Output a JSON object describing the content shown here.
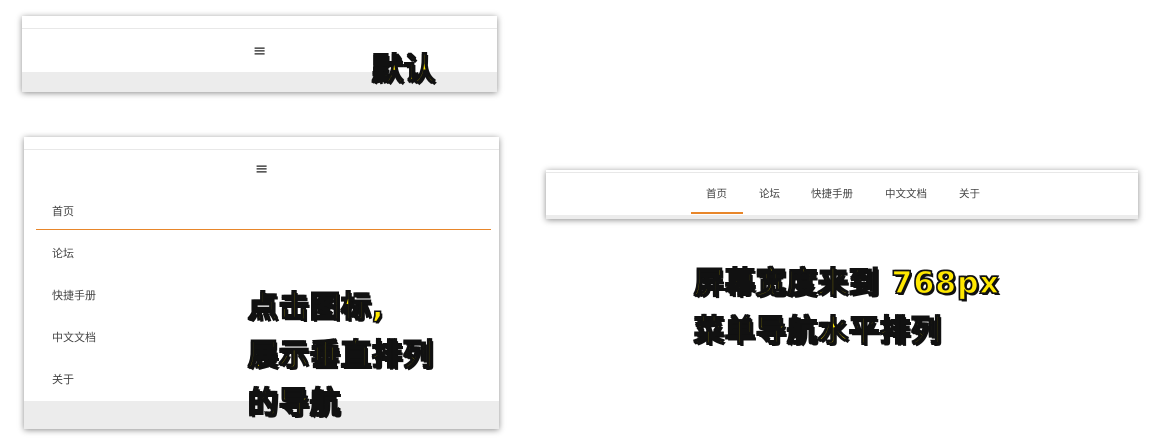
{
  "default_panel": {
    "menu_icon": "≡",
    "caption": "默认"
  },
  "vertical_panel": {
    "menu_icon": "≡",
    "nav_items": [
      "首页",
      "论坛",
      "快捷手册",
      "中文文档",
      "关于"
    ],
    "active_index": 0,
    "caption_lines": [
      "点击图标,",
      "展示垂直排列",
      "的导航"
    ]
  },
  "horizontal_panel": {
    "nav_items": [
      "首页",
      "论坛",
      "快捷手册",
      "中文文档",
      "关于"
    ],
    "active_index": 0,
    "caption_lines": [
      "屏幕宽度来到 768px",
      "菜单导航水平排列"
    ]
  },
  "colors": {
    "accent": "#e8862a",
    "caption_fill": "#ffe800",
    "caption_stroke": "#111111"
  }
}
